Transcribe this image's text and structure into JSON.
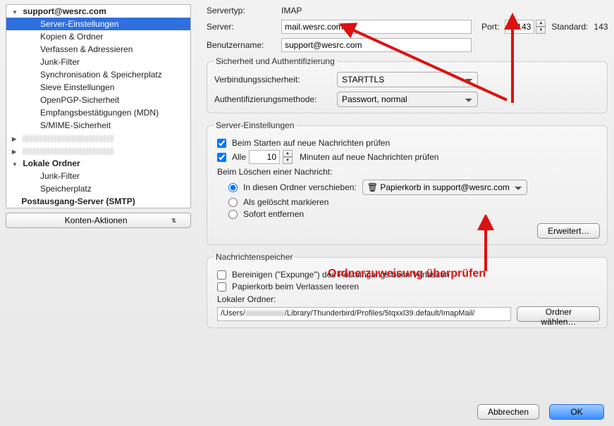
{
  "sidebar": {
    "account_email": "support@wesrc.com",
    "items": [
      "Server-Einstellungen",
      "Kopien & Ordner",
      "Verfassen & Adressieren",
      "Junk-Filter",
      "Synchronisation & Speicherplatz",
      "Sieve Einstellungen",
      "OpenPGP-Sicherheit",
      "Empfangsbestätigungen (MDN)",
      "S/MIME-Sicherheit"
    ],
    "local_folders_label": "Lokale Ordner",
    "local_sub": [
      "Junk-Filter",
      "Speicherplatz"
    ],
    "outgoing_label": "Postausgang-Server (SMTP)",
    "account_actions": "Konten-Aktionen"
  },
  "header": {
    "servertype_label": "Servertyp:",
    "servertype_value": "IMAP",
    "server_label": "Server:",
    "server_value": "mail.wesrc.com",
    "port_label": "Port:",
    "port_value": "143",
    "standard_label": "Standard:",
    "standard_value": "143",
    "username_label": "Benutzername:",
    "username_value": "support@wesrc.com"
  },
  "security": {
    "legend": "Sicherheit und Authentifizierung",
    "conn_label": "Verbindungssicherheit:",
    "conn_value": "STARTTLS",
    "auth_label": "Authentifizierungsmethode:",
    "auth_value": "Passwort, normal"
  },
  "settings": {
    "legend": "Server-Einstellungen",
    "check_startup": "Beim Starten auf neue Nachrichten prüfen",
    "check_every_prefix": "Alle",
    "check_every_minutes": "10",
    "check_every_suffix": "Minuten auf neue Nachrichten prüfen",
    "delete_label": "Beim Löschen einer Nachricht:",
    "radio_move": "In diesen Ordner verschieben:",
    "trash_target": "Papierkorb in support@wesrc.com",
    "radio_mark": "Als gelöscht markieren",
    "radio_remove": "Sofort entfernen",
    "advanced_btn": "Erweitert…"
  },
  "storage": {
    "legend": "Nachrichtenspeicher",
    "expunge": "Bereinigen (\"Expunge\") des Posteingangs beim Verlassen",
    "empty_trash": "Papierkorb beim Verlassen leeren",
    "local_folder_label": "Lokaler Ordner:",
    "local_folder_path_pre": "/Users/",
    "local_folder_path_post": "/Library/Thunderbird/Profiles/5tqxxl39.default/ImapMail/",
    "choose_btn": "Ordner wählen…"
  },
  "footer": {
    "cancel": "Abbrechen",
    "ok": "OK"
  },
  "annotation": {
    "text": "Ordnerzuweisung überprüfen"
  }
}
